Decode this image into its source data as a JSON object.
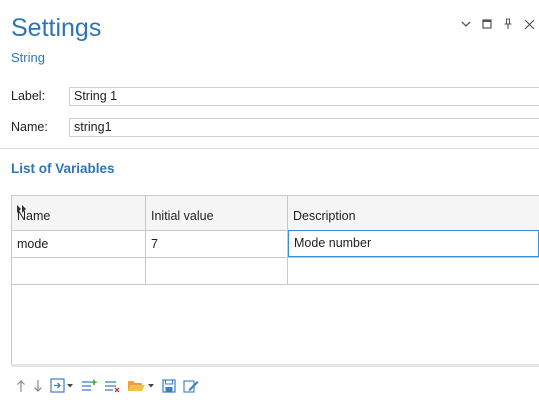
{
  "header": {
    "title": "Settings",
    "subtitle": "String"
  },
  "window_controls": [
    "chevron-down-icon",
    "maximize-icon",
    "pin-icon",
    "close-icon"
  ],
  "fields": {
    "label": {
      "label": "Label:",
      "value": "String 1"
    },
    "name": {
      "label": "Name:",
      "value": "string1"
    }
  },
  "section": {
    "title": "List of Variables"
  },
  "table": {
    "columns": [
      "Name",
      "Initial value",
      "Description"
    ],
    "rows": [
      {
        "name": "mode",
        "initial_value": "7",
        "description": "Mode number"
      },
      {
        "name": "",
        "initial_value": "",
        "description": ""
      }
    ]
  },
  "toolbar": {
    "icons": [
      "move-up-icon",
      "move-down-icon",
      "add-icon",
      "add-list-icon",
      "delete-list-icon",
      "open-folder-icon",
      "save-icon",
      "edit-icon"
    ]
  },
  "colors": {
    "accent": "#2e75b6",
    "active_cell_border": "#3b8fd9",
    "grid": "#c8c8c8",
    "header_bg": "#f5f5f5"
  }
}
